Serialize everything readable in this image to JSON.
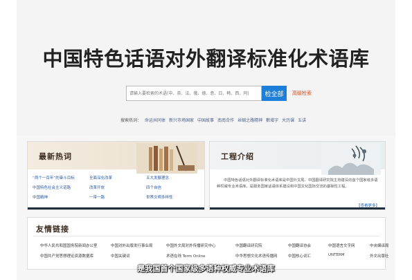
{
  "hero": {
    "site_title": "中国特色话语对外翻译标准化术语库",
    "search_placeholder": "请输入要检索的术语(中、英、法、俄、德、意、日、韩、西、阿)",
    "search_button": "检全部",
    "advanced_search": "高级检索",
    "hot_search_label": "搜索热词：",
    "hot_search_terms": [
      "命运共同体",
      "新兴市场国家",
      "中国故事",
      "南南合作",
      "丝绸之路精神",
      "數增字",
      "大历课",
      "五讲"
    ]
  },
  "hot_panel": {
    "title": "最新热词",
    "items": [
      "“两个一百年”的奋斗目标",
      "全面深化改革",
      "五大发展理念",
      "中国特色社会主义道路",
      "改革开放",
      "四个自信",
      "中国精神",
      "一带一路",
      "世界文明多样性"
    ]
  },
  "intro_panel": {
    "title": "工程介绍",
    "text": "中国特色话语对外翻译标准化术语库是中国外文局、中国翻译研究院主持建设的首个国家级多语种权威专业术语库，是服务国家话语体系建设和中国文化国际交流的基础性工程。",
    "more": "【查看更多】"
  },
  "links_panel": {
    "title": "友情链接",
    "links": [
      "中华人民共和国国务院新闻办公室",
      "中国对外出版发行事业局",
      "中国外文局对外传播研究中心",
      "中国翻译研究院",
      "中国翻译协会",
      "中国语言文字网",
      "中央编译局",
      "中国共产党思想理论资源数据库",
      "中国关键词",
      "术语在线 Term Online",
      "中华思想文化术语传播网",
      "中国核心词汇",
      "UNTERM",
      "外文出版社"
    ]
  },
  "caption": "是我国首个国家级多语种权威专业术语库"
}
